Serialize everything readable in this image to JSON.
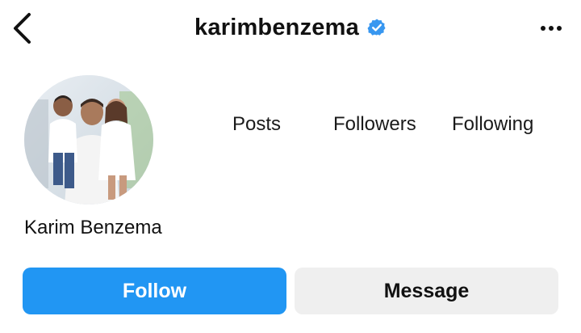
{
  "header": {
    "back_icon": "chevron-left-icon",
    "username": "karimbenzema",
    "verified_icon": "verified-badge-icon",
    "more_icon": "more-horizontal-icon"
  },
  "profile": {
    "avatar_icon": "profile-photo",
    "display_name": "Karim Benzema"
  },
  "stats": {
    "posts_label": "Posts",
    "followers_label": "Followers",
    "following_label": "Following"
  },
  "actions": {
    "follow_label": "Follow",
    "message_label": "Message"
  },
  "colors": {
    "accent": "#2196f3",
    "verified": "#3897f0",
    "secondary_button": "#efefef"
  }
}
